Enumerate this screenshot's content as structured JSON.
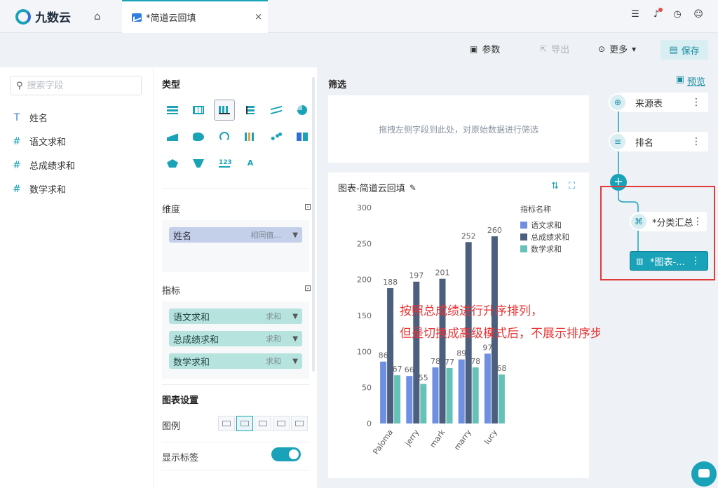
{
  "app": {
    "name": "九数云"
  },
  "tab": {
    "label": "*简道云回填",
    "close": "×"
  },
  "toolbar": {
    "params": "参数",
    "export": "导出",
    "more": "更多",
    "save": "保存"
  },
  "fields": {
    "search_placeholder": "搜索字段",
    "items": [
      {
        "type": "T",
        "label": "姓名"
      },
      {
        "type": "#",
        "label": "语文求和"
      },
      {
        "type": "#",
        "label": "总成绩求和"
      },
      {
        "type": "#",
        "label": "数学求和"
      }
    ]
  },
  "config": {
    "type_title": "类型",
    "dimension_title": "维度",
    "dimension": {
      "label": "姓名",
      "agg": "相同值..."
    },
    "measure_title": "指标",
    "measures": [
      {
        "label": "语文求和",
        "agg": "求和"
      },
      {
        "label": "总成绩求和",
        "agg": "求和"
      },
      {
        "label": "数学求和",
        "agg": "求和"
      }
    ],
    "settings_title": "图表设置",
    "legend_label": "图例",
    "show_labels_label": "显示标签"
  },
  "filter": {
    "title": "筛选",
    "hint": "拖拽左侧字段到此处，对原始数据进行筛选"
  },
  "chart": {
    "title": "图表-简道云回填"
  },
  "chart_data": {
    "type": "bar",
    "categories": [
      "Paloma",
      "jerry",
      "mark",
      "marry",
      "lucy"
    ],
    "series": [
      {
        "name": "语文求和",
        "values": [
          86,
          66,
          78,
          89,
          97
        ],
        "color": "#6f8fe0"
      },
      {
        "name": "总成绩求和",
        "values": [
          188,
          197,
          201,
          252,
          260
        ],
        "color": "#4d5f7e"
      },
      {
        "name": "数学求和",
        "values": [
          67,
          55,
          77,
          78,
          68
        ],
        "color": "#66c2b8"
      }
    ],
    "legend_title": "指标名称",
    "ylim": [
      0,
      300
    ],
    "yticks": [
      0,
      50,
      100,
      150,
      200,
      250,
      300
    ],
    "legend_position": "right",
    "grid": false
  },
  "flow": {
    "preview": "预览",
    "nodes": [
      {
        "label": "来源表"
      },
      {
        "label": "排名"
      },
      {
        "label": "*分类汇总"
      },
      {
        "label": "*图表-..."
      }
    ],
    "plus": "+"
  },
  "annotation": {
    "line1": "按照总成绩进行升序排列，",
    "line2": "但是切换成高级模式后，不展示排序步骤了"
  },
  "colors": {
    "accent": "#1aa3b8",
    "annotation": "#e83535"
  }
}
